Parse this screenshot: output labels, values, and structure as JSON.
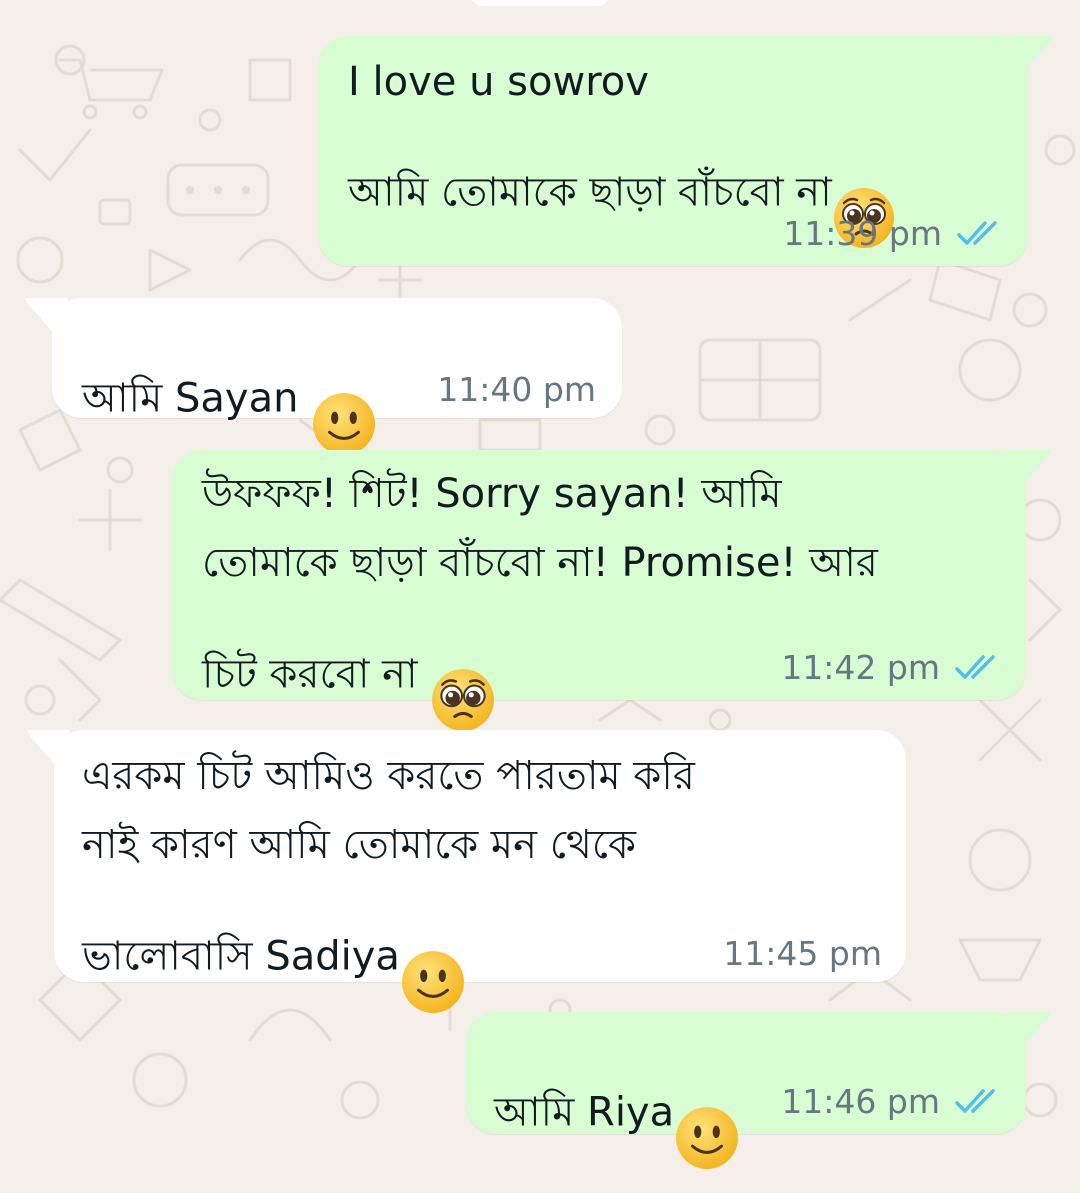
{
  "colors": {
    "outgoing_bubble": "#d9fdd3",
    "incoming_bubble": "#ffffff",
    "read_ticks": "#53bdeb",
    "timestamp": "#667781",
    "wallpaper": "#f4efe9"
  },
  "messages": [
    {
      "direction": "outgoing",
      "line1": "I love u sowrov",
      "line2": "আমি তোমাকে ছাড়া বাঁচবো না",
      "emoji": "pleading-face",
      "time": "11:39 pm",
      "status": "read"
    },
    {
      "direction": "incoming",
      "text": "আমি Sayan",
      "emoji": "slightly-smiling-face",
      "time": "11:40 pm"
    },
    {
      "direction": "outgoing",
      "line1": "উফফফ! শিট! Sorry sayan! আমি",
      "line2": "তোমাকে ছাড়া বাঁচবো না! Promise!  আর",
      "line3": "চিট করবো না",
      "emoji": "pleading-face",
      "time": "11:42 pm",
      "status": "read"
    },
    {
      "direction": "incoming",
      "line1": "এরকম চিট আমিও করতে পারতাম করি",
      "line2": "নাই কারণ আমি তোমাকে মন থেকে",
      "line3": "ভালোবাসি Sadiya",
      "emoji": "slightly-smiling-face",
      "time": "11:45 pm"
    },
    {
      "direction": "outgoing",
      "text": "আমি Riya",
      "emoji": "slightly-smiling-face",
      "time": "11:46 pm",
      "status": "read"
    }
  ]
}
